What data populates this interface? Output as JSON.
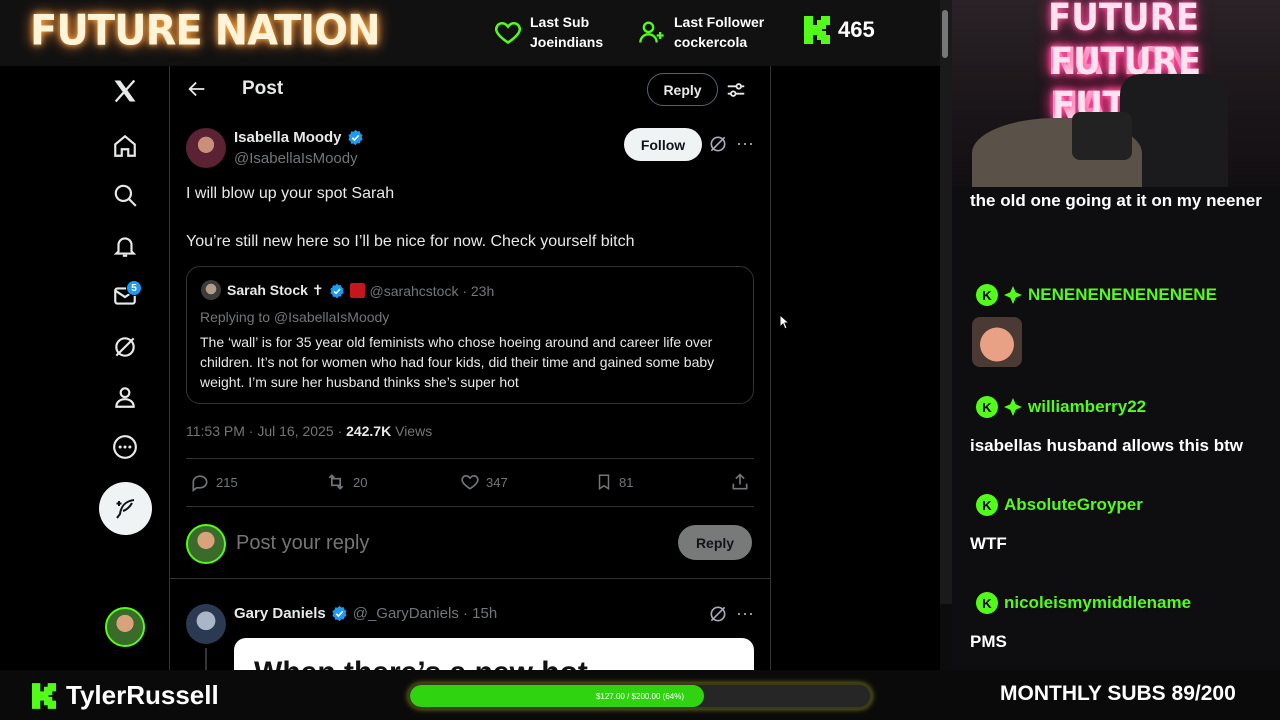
{
  "overlay": {
    "brand": "FUTURE NATION",
    "last_sub_label": "Last Sub",
    "last_sub_name": "Joeindians",
    "last_follower_label": "Last Follower",
    "last_follower_name": "cockercola",
    "kick_count": "465",
    "channel_name": "TylerRussell",
    "progress_text": "$127.00 / $200.00 (64%)",
    "progress_fraction": 0.64,
    "monthly_subs": "MONTHLY SUBS 89/200",
    "accent_color": "#53fc18"
  },
  "x": {
    "header": {
      "title": "Post",
      "reply_button": "Reply"
    },
    "nav": {
      "messages_badge": "5"
    },
    "post": {
      "author_name": "Isabella Moody",
      "author_handle": "@IsabellaIsMoody",
      "follow_label": "Follow",
      "line1": "I will blow up your spot Sarah",
      "line2": "You’re still new here so I’ll be nice for now. Check yourself bitch",
      "timestamp": "11:53 PM · Jul 16, 2025 · ",
      "views_count": "242.7K",
      "views_label": " Views",
      "stats": {
        "replies": "215",
        "reposts": "20",
        "likes": "347",
        "bookmarks": "81"
      }
    },
    "quote": {
      "author_name": "Sarah Stock ✝",
      "author_handle": "@sarahcstock · 23h",
      "replying_to": "Replying to @IsabellaIsMoody",
      "text": "The ‘wall’ is for 35 year old feminists who chose hoeing around and career life over children. It’s not for women who had four kids, did their time and gained some baby weight. I’m sure her husband thinks she’s super hot"
    },
    "reply_box": {
      "placeholder": "Post your reply",
      "button": "Reply"
    },
    "next_reply": {
      "author_name": "Gary Daniels",
      "author_handle": "@_GaryDaniels · 15h",
      "image_caption": "When there’s a new hot"
    }
  },
  "chat": {
    "cam_sign": [
      "FUTURE NATION",
      "FUTURE NATION",
      "FUTURE NATION"
    ],
    "messages": [
      {
        "text": "the old one going at it on my neener"
      },
      {
        "user": "NENENENENENENENE",
        "emote": "face"
      },
      {
        "user": "williamberry22",
        "text": "isabellas husband allows this btw"
      },
      {
        "user": "AbsoluteGroyper",
        "text": "WTF"
      },
      {
        "user": "nicoleismymiddlename",
        "text": "PMS"
      }
    ]
  }
}
